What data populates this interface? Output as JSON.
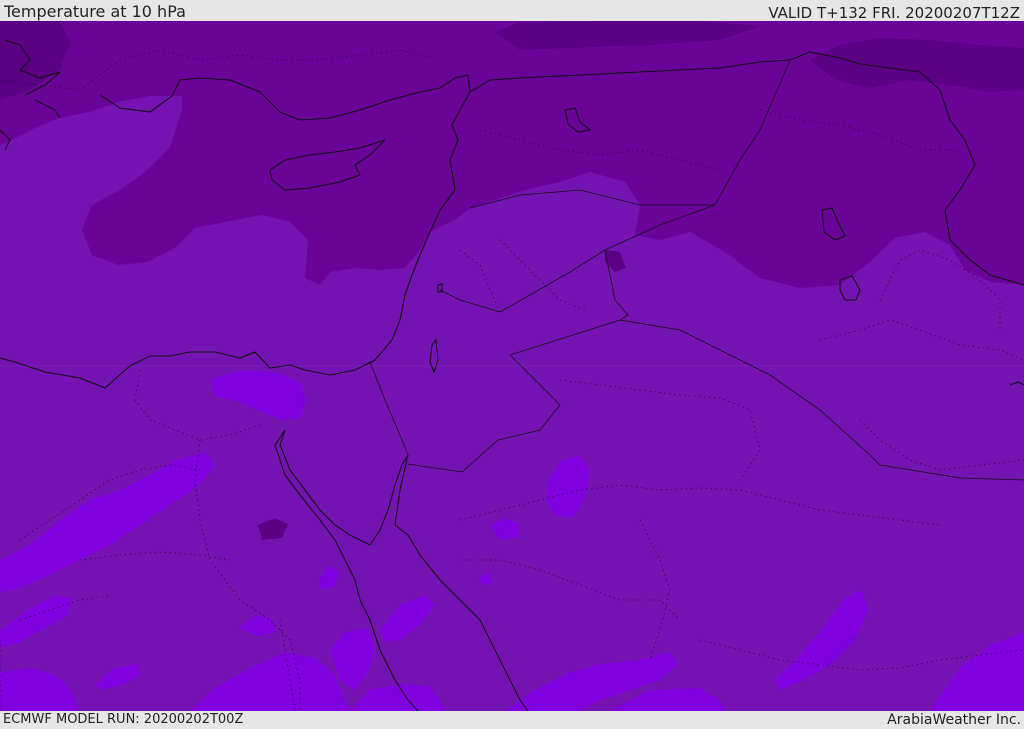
{
  "header": {
    "title": "Temperature at 10 hPa",
    "valid": "VALID T+132 FRI. 20200207T12Z"
  },
  "footer": {
    "model_run": "ECMWF MODEL RUN: 20200202T00Z",
    "credit": "ArabiaWeather Inc."
  },
  "colors": {
    "background_field": "#7513b2",
    "cold_field": "#6a0499",
    "coldest_field": "#5b0085",
    "warm_field": "#8000e0",
    "coastline": "#111111",
    "frame": "#e6e6e6"
  }
}
